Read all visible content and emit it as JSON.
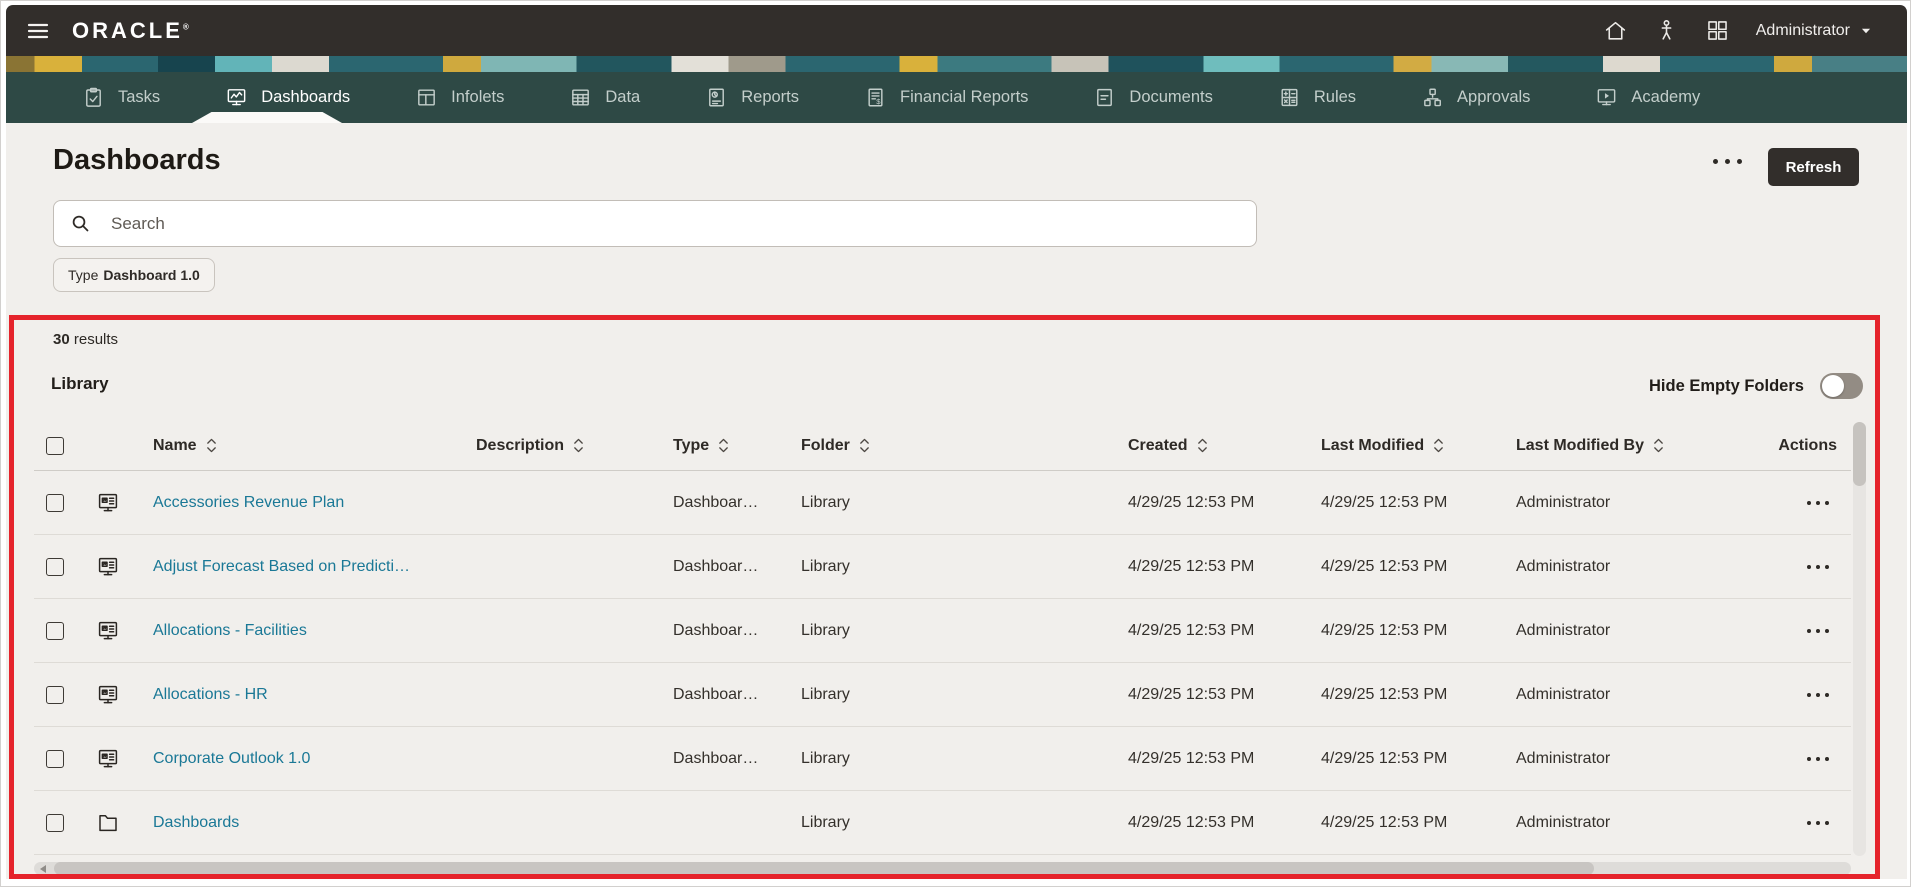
{
  "topbar": {
    "brand": "ORACLE",
    "user_label": "Administrator",
    "icons": [
      "menu-icon",
      "home-icon",
      "person-icon",
      "navigator-icon",
      "caret-down-icon"
    ]
  },
  "tabs": [
    {
      "label": "Tasks",
      "icon": "tasks-icon",
      "active": false
    },
    {
      "label": "Dashboards",
      "icon": "dashboards-icon",
      "active": true
    },
    {
      "label": "Infolets",
      "icon": "infolets-icon",
      "active": false
    },
    {
      "label": "Data",
      "icon": "data-icon",
      "active": false
    },
    {
      "label": "Reports",
      "icon": "reports-icon",
      "active": false
    },
    {
      "label": "Financial Reports",
      "icon": "financial-reports-icon",
      "active": false
    },
    {
      "label": "Documents",
      "icon": "documents-icon",
      "active": false
    },
    {
      "label": "Rules",
      "icon": "rules-icon",
      "active": false
    },
    {
      "label": "Approvals",
      "icon": "approvals-icon",
      "active": false
    },
    {
      "label": "Academy",
      "icon": "academy-icon",
      "active": false
    }
  ],
  "page": {
    "title": "Dashboards",
    "refresh_label": "Refresh"
  },
  "search": {
    "placeholder": "Search"
  },
  "filter_chip": {
    "label": "Type",
    "value": "Dashboard 1.0"
  },
  "results": {
    "count": "30",
    "count_suffix": "results",
    "section_label": "Library",
    "hide_empty_label": "Hide Empty Folders",
    "hide_empty_on": false
  },
  "table": {
    "columns": [
      {
        "label": "",
        "type": "checkbox",
        "sortable": false
      },
      {
        "label": "",
        "type": "icon",
        "sortable": false
      },
      {
        "label": "Name",
        "type": "text",
        "sortable": true
      },
      {
        "label": "Description",
        "type": "text",
        "sortable": true
      },
      {
        "label": "Type",
        "type": "text",
        "sortable": true
      },
      {
        "label": "Folder",
        "type": "text",
        "sortable": true
      },
      {
        "label": "Created",
        "type": "text",
        "sortable": true
      },
      {
        "label": "Last Modified",
        "type": "text",
        "sortable": true
      },
      {
        "label": "Last Modified By",
        "type": "text",
        "sortable": true
      },
      {
        "label": "Actions",
        "type": "actions",
        "sortable": false
      }
    ],
    "rows": [
      {
        "icon": "dashboard-item-icon",
        "name": "Accessories Revenue Plan",
        "description": "",
        "type": "Dashboar…",
        "folder": "Library",
        "created": "4/29/25 12:53 PM",
        "last_modified": "4/29/25 12:53 PM",
        "last_modified_by": "Administrator"
      },
      {
        "icon": "dashboard-item-icon",
        "name": "Adjust Forecast Based on Predicti…",
        "description": "",
        "type": "Dashboar…",
        "folder": "Library",
        "created": "4/29/25 12:53 PM",
        "last_modified": "4/29/25 12:53 PM",
        "last_modified_by": "Administrator"
      },
      {
        "icon": "dashboard-item-icon",
        "name": "Allocations - Facilities",
        "description": "",
        "type": "Dashboar…",
        "folder": "Library",
        "created": "4/29/25 12:53 PM",
        "last_modified": "4/29/25 12:53 PM",
        "last_modified_by": "Administrator"
      },
      {
        "icon": "dashboard-item-icon",
        "name": "Allocations - HR",
        "description": "",
        "type": "Dashboar…",
        "folder": "Library",
        "created": "4/29/25 12:53 PM",
        "last_modified": "4/29/25 12:53 PM",
        "last_modified_by": "Administrator"
      },
      {
        "icon": "dashboard-item-icon",
        "name": "Corporate Outlook 1.0",
        "description": "",
        "type": "Dashboar…",
        "folder": "Library",
        "created": "4/29/25 12:53 PM",
        "last_modified": "4/29/25 12:53 PM",
        "last_modified_by": "Administrator"
      },
      {
        "icon": "folder-icon",
        "name": "Dashboards",
        "description": "",
        "type": "",
        "folder": "Library",
        "created": "4/29/25 12:53 PM",
        "last_modified": "4/29/25 12:53 PM",
        "last_modified_by": "Administrator"
      }
    ]
  },
  "colors": {
    "topbar_bg": "#322e2b",
    "tabbar_bg": "#2e4945",
    "tab_text": "#c3cecb",
    "content_bg": "#f1efec",
    "link": "#1a7896",
    "button_bg": "#322e2b",
    "annotation_red": "#e5232b"
  }
}
